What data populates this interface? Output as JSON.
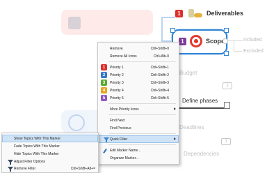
{
  "map": {
    "topics": {
      "deliverables": {
        "label": "Deliverables",
        "badge": "1"
      },
      "scope": {
        "label": "Scope",
        "badge": "1"
      },
      "define_phases": {
        "label": "Define phases"
      }
    },
    "faded_labels": {
      "budget": "Budget",
      "deadlines": "Deadlines",
      "dependencies": "Dependencies",
      "included_1": "Included",
      "included_2": "Excluded"
    }
  },
  "context_menu": {
    "items": [
      {
        "label": "Remove",
        "shortcut": "Ctrl+Shift+0"
      },
      {
        "label": "Remove All Icons",
        "shortcut": "Ctrl+Alt+0"
      },
      {
        "label": "Priority 1",
        "shortcut": "Ctrl+Shift+1",
        "badge": "1",
        "color": "#d9302c"
      },
      {
        "label": "Priority 2",
        "shortcut": "Ctrl+Shift+2",
        "badge": "2",
        "color": "#3678c8"
      },
      {
        "label": "Priority 3",
        "shortcut": "Ctrl+Shift+3",
        "badge": "3",
        "color": "#5aa833"
      },
      {
        "label": "Priority 4",
        "shortcut": "Ctrl+Shift+4",
        "badge": "4",
        "color": "#e7a51e"
      },
      {
        "label": "Priority 5",
        "shortcut": "Ctrl+Shift+5",
        "badge": "5",
        "color": "#8e5ac0"
      },
      {
        "label": "More Priority Icons"
      },
      {
        "label": "Find Next"
      },
      {
        "label": "Find Previous"
      },
      {
        "label": "Quick Filter"
      },
      {
        "label": "Edit Marker Name..."
      },
      {
        "label": "Organize Marker..."
      }
    ]
  },
  "quick_filter_submenu": {
    "items": [
      {
        "label": "Show Topics With This Marker"
      },
      {
        "label": "Fade Topics With This Marker"
      },
      {
        "label": "Hide Topics With This Marker"
      },
      {
        "label": "Adjust Filter Options"
      },
      {
        "label": "Remove Filter",
        "shortcut": "Ctrl+Shift+Alt+="
      }
    ]
  },
  "colors": {
    "accent": "#2f86d6",
    "highlight": "#cfe3f7"
  }
}
